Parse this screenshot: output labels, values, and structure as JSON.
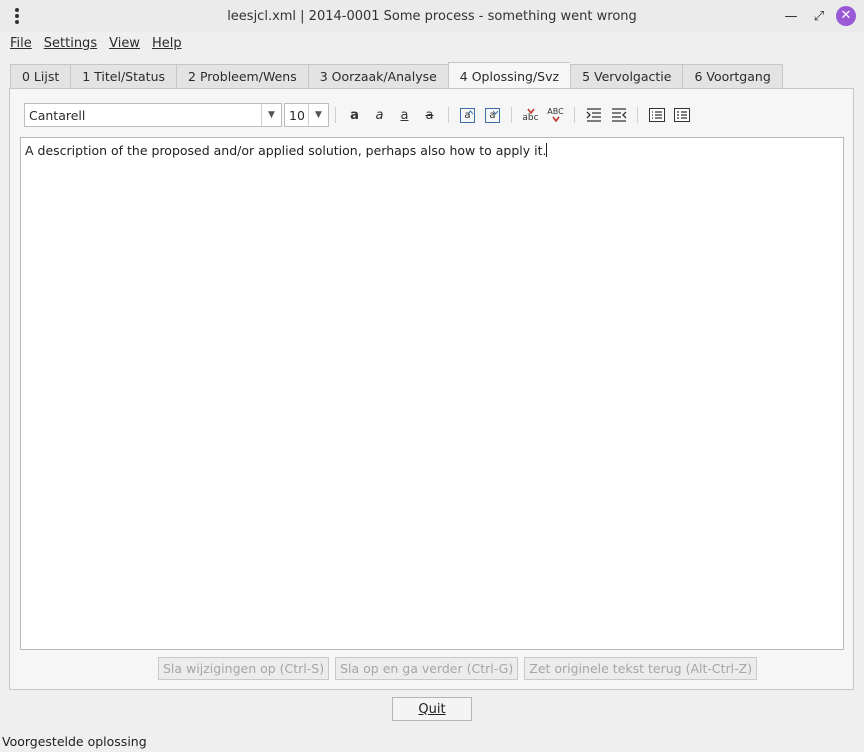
{
  "window": {
    "title": "leesjcl.xml | 2014-0001 Some process - something went wrong",
    "close_glyph": "✕",
    "minimize_glyph": "—",
    "maximize_glyph": "⤢"
  },
  "menubar": {
    "items": [
      {
        "label": "File"
      },
      {
        "label": "Settings"
      },
      {
        "label": "View"
      },
      {
        "label": "Help"
      }
    ]
  },
  "tabs": [
    {
      "label": "0 Lijst",
      "active": false
    },
    {
      "label": "1 Titel/Status",
      "active": false
    },
    {
      "label": "2 Probleem/Wens",
      "active": false
    },
    {
      "label": "3 Oorzaak/Analyse",
      "active": false
    },
    {
      "label": "4 Oplossing/Svz",
      "active": true
    },
    {
      "label": "5 Vervolgactie",
      "active": false
    },
    {
      "label": "6 Voortgang",
      "active": false
    }
  ],
  "toolbar": {
    "font_family": "Cantarell",
    "font_size": "10",
    "format_glyph": "a",
    "spell_label": "abc",
    "spell_caps_label": "ABC"
  },
  "editor": {
    "text": "A description of the proposed and/or applied solution, perhaps also how to apply it."
  },
  "actions": {
    "save": "Sla wijzigingen op (Ctrl-S)",
    "save_next": "Sla op en ga verder (Ctrl-G)",
    "revert": "Zet originele tekst terug (Alt-Ctrl-Z)"
  },
  "quit_label": "Quit",
  "statusbar": {
    "text": "Voorgestelde oplossing"
  },
  "colors": {
    "accent_close": "#9a5ad6",
    "icon_blue": "#3a6ea5",
    "spell_red": "#c0392b"
  }
}
